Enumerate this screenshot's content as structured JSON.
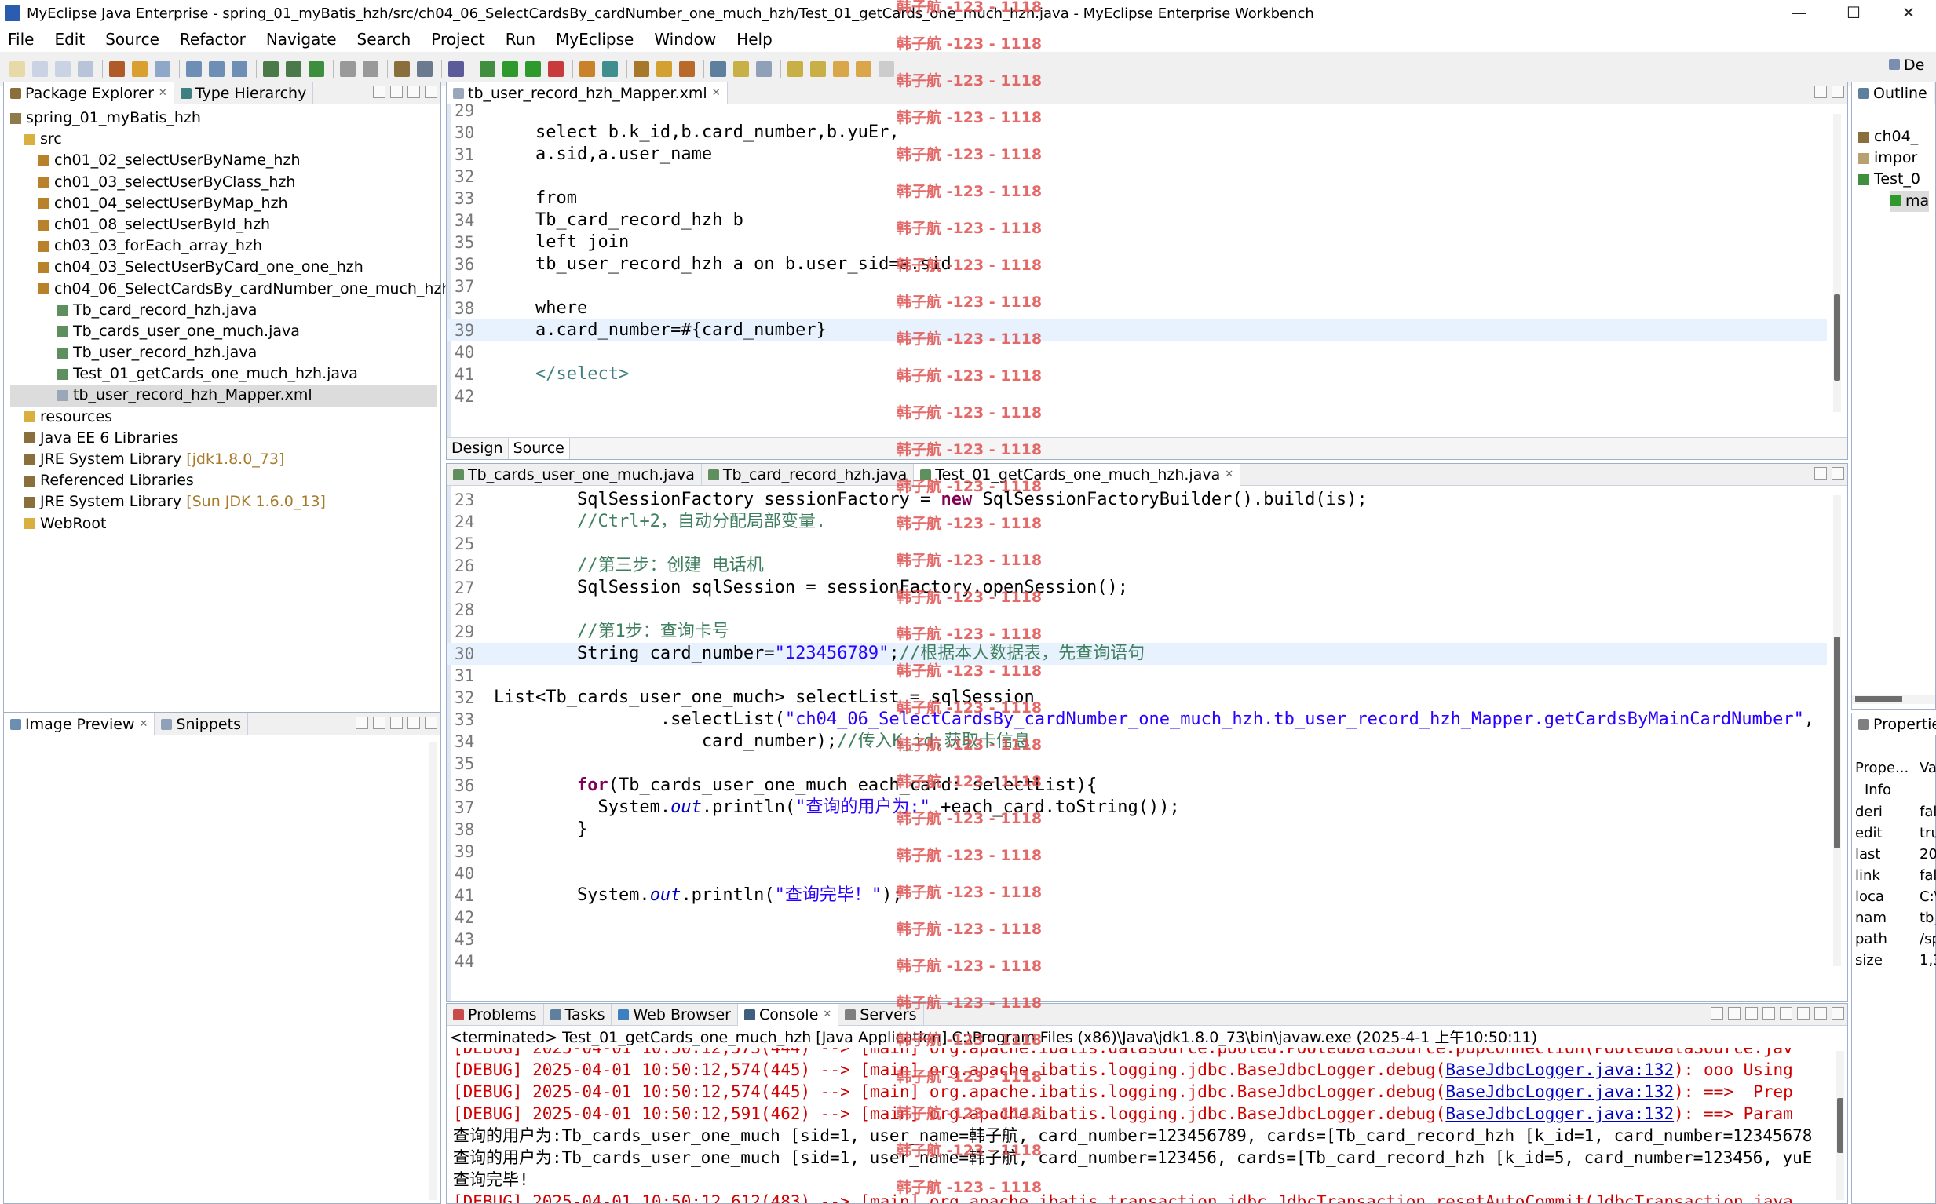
{
  "window": {
    "title": "MyEclipse Java Enterprise - spring_01_myBatis_hzh/src/ch04_06_SelectCardsBy_cardNumber_one_much_hzh/Test_01_getCards_one_much_hzh.java - MyEclipse Enterprise Workbench",
    "min": "—",
    "max": "☐",
    "close": "✕"
  },
  "menu": [
    "File",
    "Edit",
    "Source",
    "Refactor",
    "Navigate",
    "Search",
    "Project",
    "Run",
    "MyEclipse",
    "Window",
    "Help"
  ],
  "watermark": "韩子航 -123 - 1118",
  "package_explorer": {
    "tab1": "Package Explorer",
    "tab2": "Type Hierarchy",
    "items": [
      {
        "label": "spring_01_myBatis_hzh",
        "depth": 0
      },
      {
        "label": "src",
        "depth": 1
      },
      {
        "label": "ch01_02_selectUserByName_hzh",
        "depth": 2
      },
      {
        "label": "ch01_03_selectUserByClass_hzh",
        "depth": 2
      },
      {
        "label": "ch01_04_selectUserByMap_hzh",
        "depth": 2
      },
      {
        "label": "ch01_08_selectUserById_hzh",
        "depth": 2
      },
      {
        "label": "ch03_03_forEach_array_hzh",
        "depth": 2
      },
      {
        "label": "ch04_03_SelectUserByCard_one_one_hzh",
        "depth": 2
      },
      {
        "label": "ch04_06_SelectCardsBy_cardNumber_one_much_hzh",
        "depth": 2
      },
      {
        "label": "Tb_card_record_hzh.java",
        "depth": 3
      },
      {
        "label": "Tb_cards_user_one_much.java",
        "depth": 3
      },
      {
        "label": "Tb_user_record_hzh.java",
        "depth": 3
      },
      {
        "label": "Test_01_getCards_one_much_hzh.java",
        "depth": 3
      },
      {
        "label": "tb_user_record_hzh_Mapper.xml",
        "depth": 3
      },
      {
        "label": "resources",
        "depth": 1
      },
      {
        "label": "Java EE 6 Libraries",
        "depth": 1
      },
      {
        "label": "JRE System Library",
        "decor": "[jdk1.8.0_73]",
        "depth": 1
      },
      {
        "label": "Referenced Libraries",
        "depth": 1
      },
      {
        "label": "JRE System Library",
        "decor": "[Sun JDK 1.6.0_13]",
        "depth": 1
      },
      {
        "label": "WebRoot",
        "depth": 1
      }
    ]
  },
  "image_preview": {
    "tab1": "Image Preview",
    "tab2": "Snippets"
  },
  "xml_editor": {
    "tab": "tb_user_record_hzh_Mapper.xml",
    "design": "Design",
    "source": "Source"
  },
  "java_editor": {
    "tabs": [
      "Tb_cards_user_one_much.java",
      "Tb_card_record_hzh.java",
      "Test_01_getCards_one_much_hzh.java"
    ]
  },
  "outline": {
    "tab": "Outline",
    "items": [
      "ch04_",
      "impor",
      "Test_0",
      "ma"
    ]
  },
  "properties": {
    "tab": "Propertie",
    "col1": "Prope...",
    "col2": "Va",
    "group": "Info",
    "rows": [
      [
        "deri",
        "fals"
      ],
      [
        "edit",
        "tru"
      ],
      [
        "last",
        "20"
      ],
      [
        "link",
        "fals"
      ],
      [
        "loca",
        "C:\\"
      ],
      [
        "nam",
        "tb_"
      ],
      [
        "path",
        "/sp"
      ],
      [
        "size",
        "1,3"
      ]
    ]
  },
  "right_top_btn": "De",
  "console": {
    "tabs": [
      "Problems",
      "Tasks",
      "Web Browser",
      "Console",
      "Servers"
    ],
    "header": "<terminated> Test_01_getCards_one_much_hzh [Java Application] C:\\Program Files (x86)\\Java\\jdk1.8.0_73\\bin\\javaw.exe (2025-4-1 上午10:50:11)",
    "top_partial": "[DEBUG] 2025-04-01 10:50:12,573(444) --> [main] org.apache.ibatis.datasource.pooled.PooledDataSource.popConnection(PooledDataSource.jav",
    "debug": [
      {
        "pre": "[DEBUG] 2025-04-01 10:50:12,574(445) --> [main] org.apache.ibatis.logging.jdbc.BaseJdbcLogger.debug(",
        "link": "BaseJdbcLogger.java:132",
        "post": "): ooo Using"
      },
      {
        "pre": "[DEBUG] 2025-04-01 10:50:12,574(445) --> [main] org.apache.ibatis.logging.jdbc.BaseJdbcLogger.debug(",
        "link": "BaseJdbcLogger.java:132",
        "post": "): ==>  Prep"
      },
      {
        "pre": "[DEBUG] 2025-04-01 10:50:12,591(462) --> [main] org.apache.ibatis.logging.jdbc.BaseJdbcLogger.debug(",
        "link": "BaseJdbcLogger.java:132",
        "post": "): ==> Param"
      }
    ],
    "out1": "查询的用户为:Tb_cards_user_one_much [sid=1, user_name=韩子航, card_number=123456789, cards=[Tb_card_record_hzh [k_id=1, card_number=12345678",
    "out2": "查询的用户为:Tb_cards_user_one_much [sid=1, user_name=韩子航, card_number=123456, cards=[Tb_card_record_hzh [k_id=5, card_number=123456, yuE",
    "out3": "查询完毕!",
    "last": "[DEBUG] 2025-04-01 10:50:12,612(483) --> [main] org.apache.ibatis.transaction.jdbc.JdbcTransaction.resetAutoCommit(JdbcTransaction.java"
  }
}
